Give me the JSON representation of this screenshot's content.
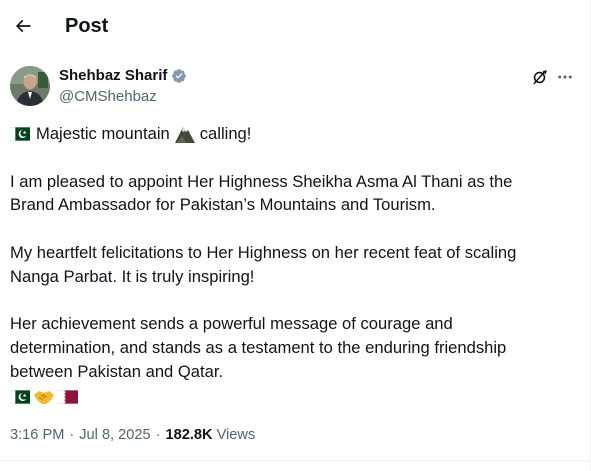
{
  "header": {
    "title": "Post",
    "back_icon": "arrow-left-icon"
  },
  "author": {
    "name": "Shehbaz Sharif",
    "handle": "@CMShehbaz",
    "verified_icon": "verified-badge-icon",
    "verified_color": "#829aab"
  },
  "actions": {
    "grok_icon": "grok-icon",
    "more_icon": "more-dots-icon"
  },
  "post": {
    "line1_before": "Majestic mountain",
    "line1_after": "calling!",
    "paragraph2_line1": "I am pleased to appoint Her Highness Sheikha Asma Al Thani as the",
    "paragraph2_line2": "Brand Ambassador for Pakistan’s Mountains and Tourism.",
    "paragraph3_line1": "My heartfelt felicitations to Her Highness on her recent feat of scaling",
    "paragraph3_line2": "Nanga Parbat. It is truly inspiring!",
    "paragraph4_line1": "Her achievement sends a powerful message of courage and",
    "paragraph4_line2": "determination, and stands as a testament to the enduring friendship",
    "paragraph4_line3": "between Pakistan and Qatar.",
    "emojis": [
      "pakistan-flag-icon",
      "handshake-icon",
      "qatar-flag-icon"
    ]
  },
  "meta": {
    "time": "3:16 PM",
    "separator": "·",
    "date": "Jul 8, 2025",
    "separator2": "·",
    "views_count": "182.8K",
    "views_label": "Views"
  },
  "colors": {
    "text": "#0f1419",
    "secondary": "#536471",
    "pakistan_green": "#01411c",
    "qatar_maroon": "#8a1538",
    "handshake": "#f5b82e"
  }
}
